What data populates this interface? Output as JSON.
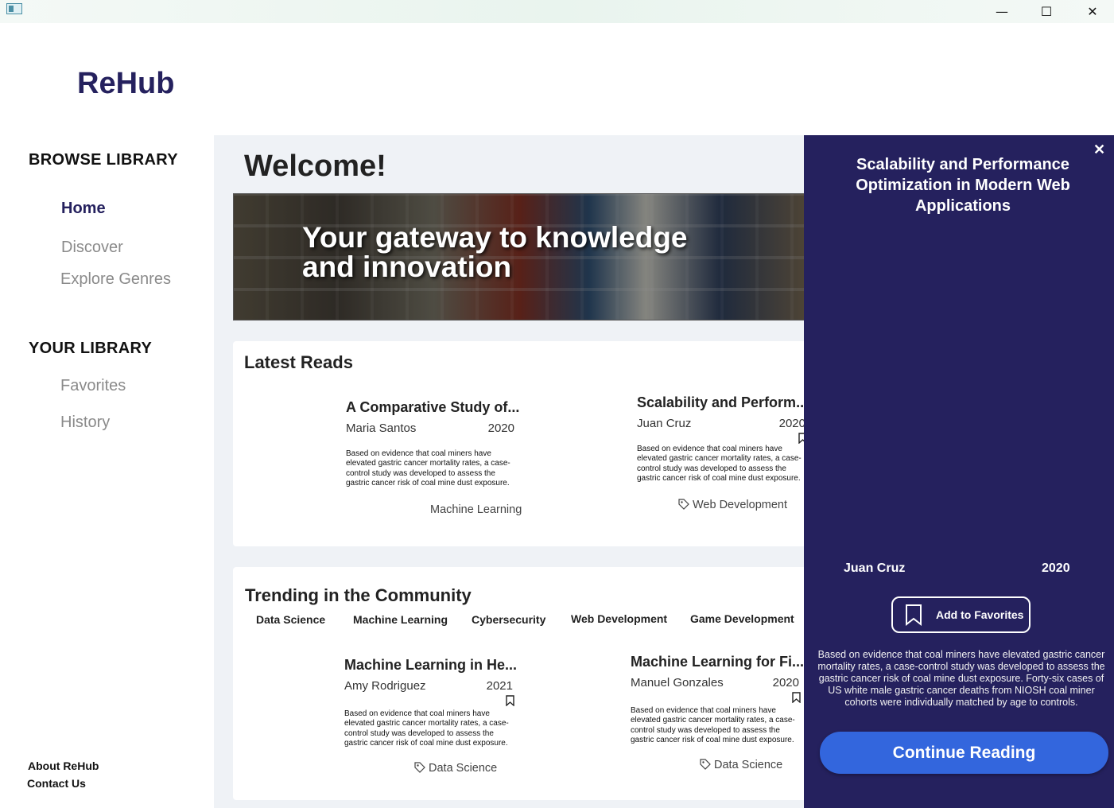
{
  "window": {
    "minimize_glyph": "—",
    "maximize_glyph": "☐",
    "close_glyph": "✕"
  },
  "brand": "ReHub",
  "sidebar": {
    "browse_heading": "BROWSE  LIBRARY",
    "browse_items": [
      {
        "label": "Home",
        "active": true
      },
      {
        "label": "Discover",
        "active": false
      },
      {
        "label": "Explore Genres",
        "active": false
      }
    ],
    "library_heading": "YOUR  LIBRARY",
    "library_items": [
      {
        "label": "Favorites"
      },
      {
        "label": "History"
      }
    ],
    "footer": {
      "about": "About ReHub",
      "contact": "Contact Us"
    }
  },
  "main": {
    "welcome": "Welcome!",
    "banner_line1": "Your gateway to knowledge",
    "banner_line2": "and innovation",
    "latest": {
      "title": "Latest Reads",
      "books": [
        {
          "title": "A Comparative Study of...",
          "author": "Maria Santos",
          "year": "2020",
          "description": "Based on evidence that coal miners have elevated gastric cancer mortality rates, a case-control study was developed to assess the gastric cancer risk of coal mine dust exposure.",
          "genre": "Machine Learning"
        },
        {
          "title": "Scalability and Perform...",
          "author": "Juan Cruz",
          "year": "2020",
          "description": "Based on evidence that coal miners have elevated gastric cancer mortality rates, a case-control study was developed to assess the gastric cancer risk of coal mine dust exposure.",
          "genre": "Web Development"
        }
      ]
    },
    "trending": {
      "title": "Trending in the Community",
      "genres": [
        "Data Science",
        "Machine Learning",
        "Cybersecurity",
        "Web Development",
        "Game Development"
      ],
      "books": [
        {
          "title": "Machine Learning in He...",
          "author": "Amy Rodriguez",
          "year": "2021",
          "description": "Based on evidence that coal miners have elevated gastric cancer mortality rates, a case-control study was developed to assess the gastric cancer risk of coal mine dust exposure.",
          "genre": "Data Science"
        },
        {
          "title": "Machine Learning for Fi...",
          "author": "Manuel Gonzales",
          "year": "2020",
          "description": "Based on evidence that coal miners have elevated gastric cancer mortality rates, a case-control study was developed to assess the gastric cancer risk of coal mine dust exposure.",
          "genre": "Data Science"
        }
      ]
    }
  },
  "detail": {
    "close_glyph": "✕",
    "title": "Scalability and Performance Optimization in Modern Web Applications",
    "author": "Juan Cruz",
    "year": "2020",
    "favorites_label": "Add to Favorites",
    "description": "Based on evidence that coal miners have elevated gastric cancer mortality rates, a case-control study was developed to assess the gastric cancer risk of coal mine dust exposure. Forty-six cases of US white male gastric cancer deaths from NIOSH coal miner cohorts were individually matched by age to controls.",
    "continue_label": "Continue Reading",
    "accent_color": "#3366dd",
    "panel_color": "#25215e"
  }
}
